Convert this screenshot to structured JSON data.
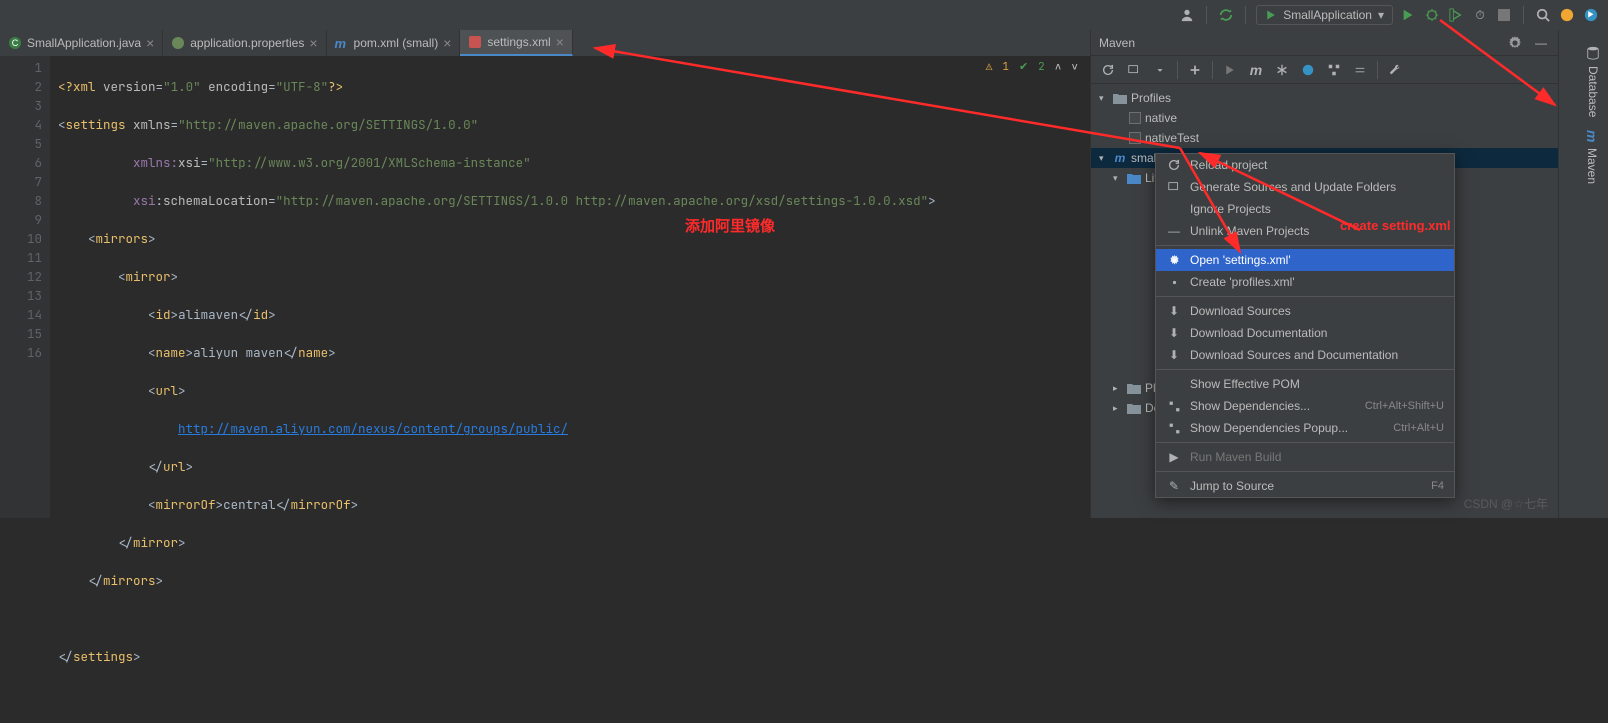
{
  "toolbar": {
    "run_config": "SmallApplication"
  },
  "tabs": [
    {
      "label": "SmallApplication.java"
    },
    {
      "label": "application.properties"
    },
    {
      "label": "pom.xml (small)"
    },
    {
      "label": "settings.xml"
    }
  ],
  "inspection": {
    "warn": "1",
    "ok": "2"
  },
  "code_lines": [
    "<?xml version=\"1.0\" encoding=\"UTF-8\"?>",
    "<settings xmlns=\"http://maven.apache.org/SETTINGS/1.0.0\"",
    "          xmlns:xsi=\"http://www.w3.org/2001/XMLSchema-instance\"",
    "          xsi:schemaLocation=\"http://maven.apache.org/SETTINGS/1.0.0 http://maven.apache.org/xsd/settings-1.0.0.xsd\">",
    "    <mirrors>",
    "        <mirror>",
    "            <id>alimaven</id>",
    "            <name>aliyun maven</name>",
    "            <url>",
    "                http://maven.aliyun.com/nexus/content/groups/public/",
    "            </url>",
    "            <mirrorOf>central</mirrorOf>",
    "        </mirror>",
    "    </mirrors>",
    "",
    "</settings>"
  ],
  "gutter": [
    "1",
    "2",
    "3",
    "4",
    "5",
    "6",
    "7",
    "8",
    "9",
    "10",
    "11",
    "12",
    "13",
    "14",
    "15",
    "16"
  ],
  "maven": {
    "title": "Maven",
    "tree": {
      "profiles": "Profiles",
      "native": "native",
      "nativeTest": "nativeTest",
      "project": "small",
      "lifecycle": "Life",
      "plugins": "Plu",
      "deps": "Dep"
    }
  },
  "ctx": {
    "reload": "Reload project",
    "generate": "Generate Sources and Update Folders",
    "ignore": "Ignore Projects",
    "unlink": "Unlink Maven Projects",
    "open_settings": "Open 'settings.xml'",
    "create_profiles": "Create 'profiles.xml'",
    "dl_sources": "Download Sources",
    "dl_docs": "Download Documentation",
    "dl_both": "Download Sources and Documentation",
    "effective": "Show Effective POM",
    "show_deps": "Show Dependencies...",
    "show_deps_sc": "Ctrl+Alt+Shift+U",
    "show_deps_popup": "Show Dependencies Popup...",
    "show_deps_popup_sc": "Ctrl+Alt+U",
    "run_build": "Run Maven Build",
    "jump": "Jump to Source",
    "jump_sc": "F4"
  },
  "strip": {
    "database": "Database",
    "maven": "Maven"
  },
  "anno": {
    "add_mirror": "添加阿里镜像",
    "create_setting": "create setting.xml"
  },
  "watermark": "CSDN @☆七年"
}
